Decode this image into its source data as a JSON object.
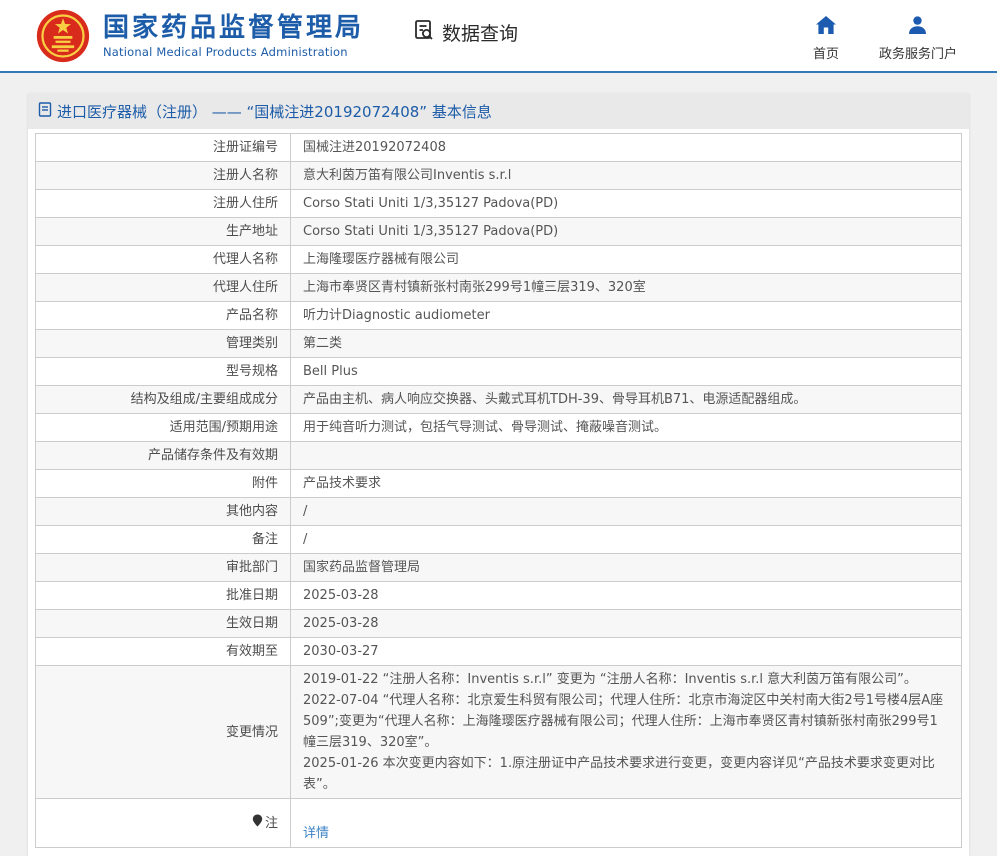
{
  "header": {
    "org_name_cn": "国家药品监督管理局",
    "org_name_en": "National Medical Products Administration",
    "nav_data_query": "数据查询",
    "nav_home": "首页",
    "nav_portal": "政务服务门户"
  },
  "icons": {
    "logo": "china-national-emblem",
    "data_query": "document-magnifier-icon",
    "home": "house-icon",
    "portal": "person-icon",
    "page_title": "document-icon",
    "note": "pin-icon"
  },
  "colors": {
    "brand_blue": "#1c5ca8",
    "header_line": "#3379b7",
    "link_blue": "#3d85c6",
    "alt_row": "#f7f7f7",
    "title_bar_bg": "#e9e9e9",
    "emblem_red": "#d92b1c",
    "emblem_gold": "#f8cf43"
  },
  "page": {
    "title": "进口医疗器械（注册） —— “国械注进20192072408” 基本信息"
  },
  "table": {
    "rows": [
      {
        "label": "注册证编号",
        "value": "国械注进20192072408"
      },
      {
        "label": "注册人名称",
        "value": "意大利茵万笛有限公司Inventis s.r.l"
      },
      {
        "label": "注册人住所",
        "value": "Corso Stati Uniti 1/3,35127 Padova(PD)"
      },
      {
        "label": "生产地址",
        "value": "Corso Stati Uniti 1/3,35127 Padova(PD)"
      },
      {
        "label": "代理人名称",
        "value": "上海隆璎医疗器械有限公司"
      },
      {
        "label": "代理人住所",
        "value": "上海市奉贤区青村镇新张村南张299号1幢三层319、320室"
      },
      {
        "label": "产品名称",
        "value": "听力计Diagnostic audiometer"
      },
      {
        "label": "管理类别",
        "value": "第二类"
      },
      {
        "label": "型号规格",
        "value": "Bell Plus"
      },
      {
        "label": "结构及组成/主要组成成分",
        "value": "产品由主机、病人响应交换器、头戴式耳机TDH-39、骨导耳机B71、电源适配器组成。"
      },
      {
        "label": "适用范围/预期用途",
        "value": "用于纯音听力测试，包括气导测试、骨导测试、掩蔽噪音测试。"
      },
      {
        "label": "产品储存条件及有效期",
        "value": ""
      },
      {
        "label": "附件",
        "value": "产品技术要求"
      },
      {
        "label": "其他内容",
        "value": "/"
      },
      {
        "label": "备注",
        "value": "/"
      },
      {
        "label": "审批部门",
        "value": "国家药品监督管理局"
      },
      {
        "label": "批准日期",
        "value": "2025-03-28"
      },
      {
        "label": "生效日期",
        "value": "2025-03-28"
      },
      {
        "label": "有效期至",
        "value": "2030-03-27"
      },
      {
        "label": "变更情况",
        "value": "2019-01-22 “注册人名称：Inventis s.r.l” 变更为 “注册人名称：Inventis s.r.l 意大利茵万笛有限公司”。\n2022-07-04 “代理人名称：北京爱生科贸有限公司；代理人住所：北京市海淀区中关村南大街2号1号楼4层A座509”;变更为“代理人名称：上海隆璎医疗器械有限公司；代理人住所：上海市奉贤区青村镇新张村南张299号1幢三层319、320室”。\n2025-01-26 本次变更内容如下：1.原注册证中产品技术要求进行变更，变更内容详见“产品技术要求变更对比表”。"
      }
    ],
    "note_row": {
      "label": "注",
      "link": "详情"
    }
  }
}
